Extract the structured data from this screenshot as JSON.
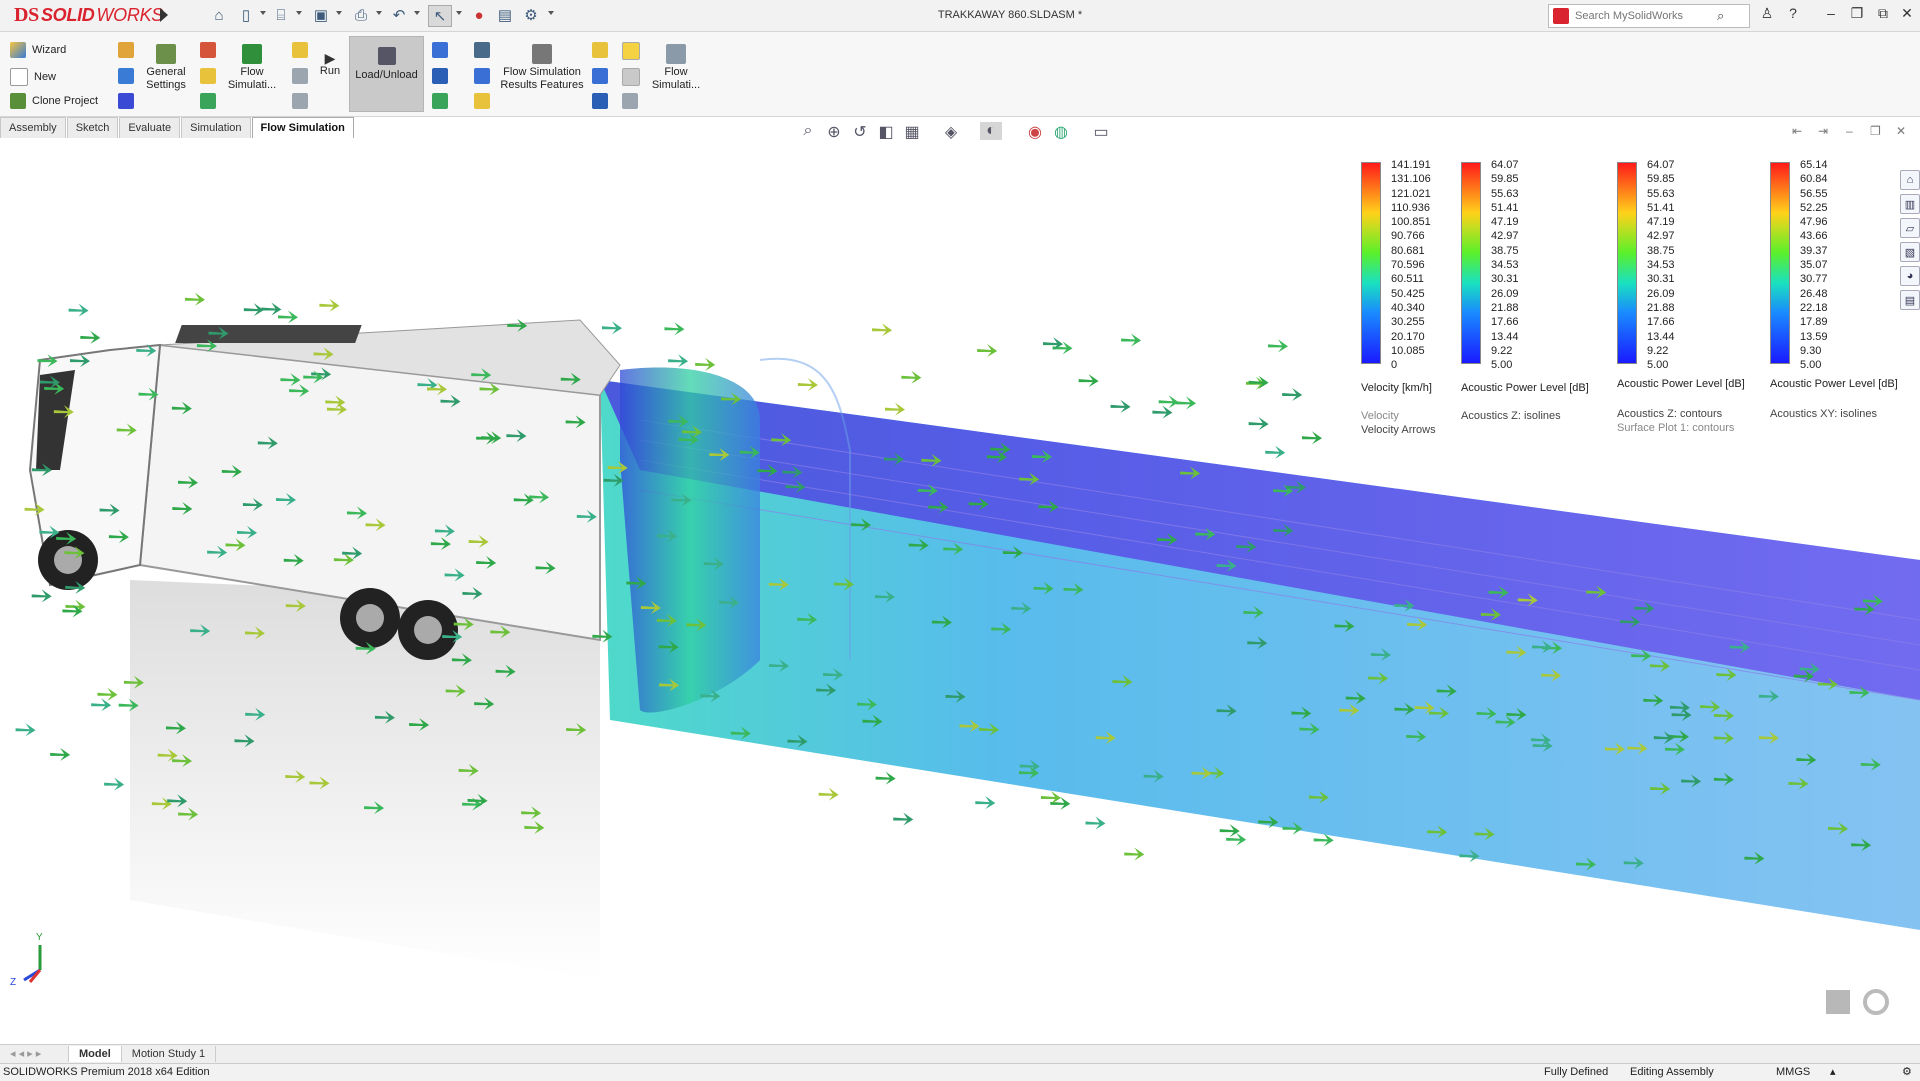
{
  "app": {
    "logo_ds": "DS",
    "logo_solid": "SOLID",
    "logo_works": "WORKS",
    "document_title": "TRAKKAWAY 860.SLDASM *"
  },
  "search": {
    "placeholder": "Search MySolidWorks"
  },
  "ribbon": {
    "wizard": "Wizard",
    "new": "New",
    "clone_project": "Clone Project",
    "general_settings": "General Settings",
    "flow_simulation_1": "Flow Simulati...",
    "run": "Run",
    "load_unload": "Load/Unload",
    "flow_sim_results_features": "Flow Simulation Results Features",
    "flow_simulation_2": "Flow Simulati..."
  },
  "tabs": [
    "Assembly",
    "Sketch",
    "Evaluate",
    "Simulation",
    "Flow Simulation"
  ],
  "active_tab": "Flow Simulation",
  "legends": [
    {
      "values": [
        "141.191",
        "131.106",
        "121.021",
        "110.936",
        "100.851",
        "90.766",
        "80.681",
        "70.596",
        "60.511",
        "50.425",
        "40.340",
        "30.255",
        "20.170",
        "10.085",
        "0"
      ],
      "caption": "Velocity [km/h]",
      "subtitle": "Velocity",
      "subtitle2": "Velocity Arrows"
    },
    {
      "values": [
        "64.07",
        "59.85",
        "55.63",
        "51.41",
        "47.19",
        "42.97",
        "38.75",
        "34.53",
        "30.31",
        "26.09",
        "21.88",
        "17.66",
        "13.44",
        "9.22",
        "5.00"
      ],
      "caption": "Acoustic Power Level [dB]",
      "subtitle": "Acoustics Z: isolines"
    },
    {
      "values": [
        "64.07",
        "59.85",
        "55.63",
        "51.41",
        "47.19",
        "42.97",
        "38.75",
        "34.53",
        "30.31",
        "26.09",
        "21.88",
        "17.66",
        "13.44",
        "9.22",
        "5.00"
      ],
      "caption": "Acoustic Power Level [dB]",
      "subtitle": "Acoustics Z: contours",
      "subtitle2": "Surface Plot 1: contours"
    },
    {
      "values": [
        "65.14",
        "60.84",
        "56.55",
        "52.25",
        "47.96",
        "43.66",
        "39.37",
        "35.07",
        "30.77",
        "26.48",
        "22.18",
        "17.89",
        "13.59",
        "9.30",
        "5.00"
      ],
      "caption": "Acoustic Power Level [dB]",
      "subtitle": "Acoustics XY: isolines"
    }
  ],
  "triad": {
    "y": "Y",
    "z": "Z"
  },
  "bottom_tabs": [
    "Model",
    "Motion Study 1"
  ],
  "status": {
    "edition": "SOLIDWORKS Premium 2018 x64 Edition",
    "defined": "Fully Defined",
    "mode": "Editing Assembly",
    "units": "MMGS"
  },
  "colors": {
    "accent": "#d9232e",
    "ribbon_bg": "#f7f7f7"
  }
}
